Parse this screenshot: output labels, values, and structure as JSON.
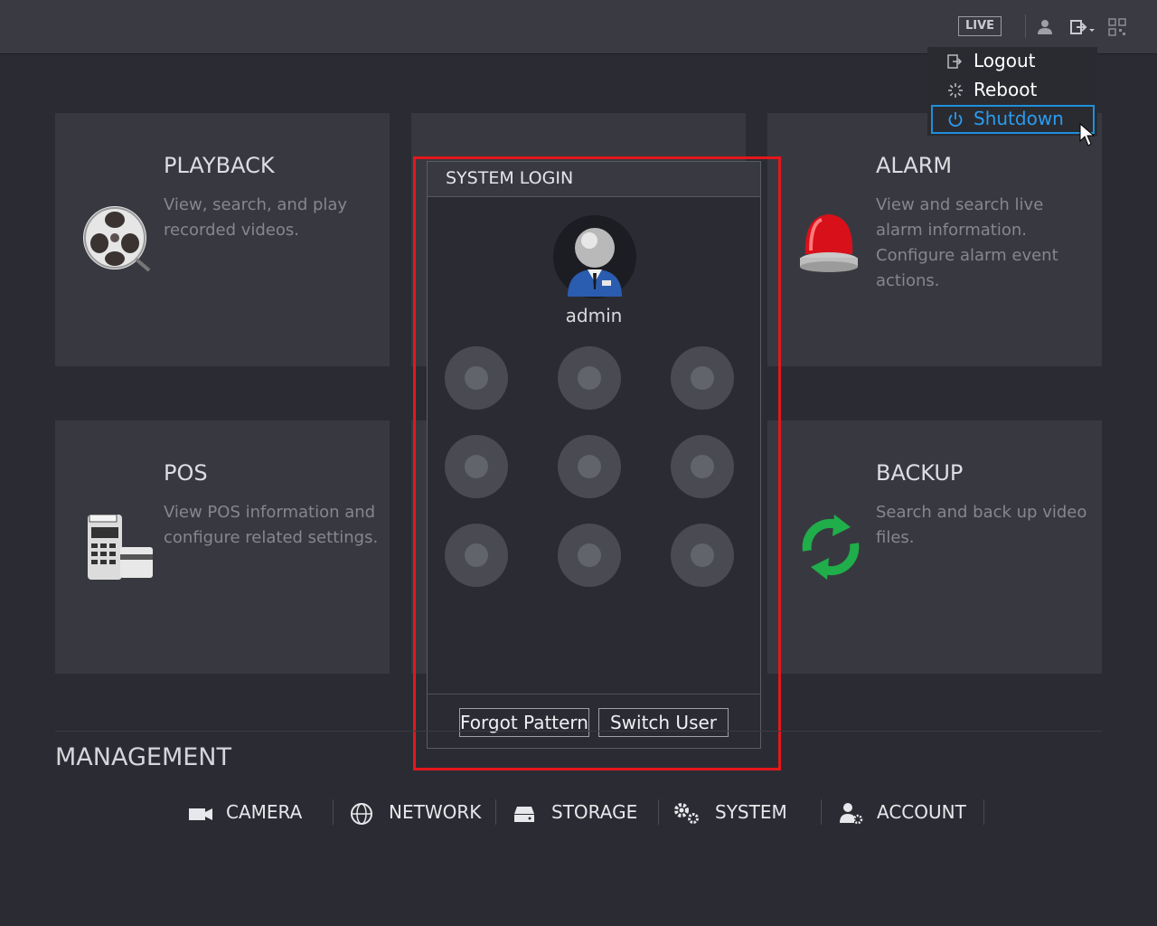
{
  "topbar": {
    "live_label": "LIVE",
    "icons": [
      "user-icon",
      "logout-menu-icon",
      "qr-code-icon"
    ]
  },
  "power_menu": {
    "items": [
      {
        "label": "Logout",
        "icon": "logout-icon"
      },
      {
        "label": "Reboot",
        "icon": "reboot-icon"
      },
      {
        "label": "Shutdown",
        "icon": "power-icon",
        "selected": true
      }
    ]
  },
  "tiles": {
    "playback": {
      "title": "PLAYBACK",
      "desc": "View, search, and play recorded videos.",
      "icon": "film-reel-icon"
    },
    "alarm": {
      "title": "ALARM",
      "desc": "View and search live alarm information. Configure alarm event actions.",
      "icon": "alarm-siren-icon"
    },
    "pos": {
      "title": "POS",
      "desc": "View POS information and configure related settings.",
      "icon": "cash-register-icon"
    },
    "backup": {
      "title": "BACKUP",
      "desc": "Search and back up video files.",
      "icon": "sync-arrows-icon"
    }
  },
  "login": {
    "title": "SYSTEM LOGIN",
    "username": "admin",
    "pattern_grid": "3x3",
    "forgot_label": "Forgot Pattern",
    "switch_label": "Switch User"
  },
  "management": {
    "title": "MANAGEMENT",
    "items": [
      {
        "label": "CAMERA",
        "icon": "camera-icon"
      },
      {
        "label": "NETWORK",
        "icon": "globe-icon"
      },
      {
        "label": "STORAGE",
        "icon": "hard-drive-icon"
      },
      {
        "label": "SYSTEM",
        "icon": "gears-icon"
      },
      {
        "label": "ACCOUNT",
        "icon": "user-settings-icon"
      }
    ]
  },
  "colors": {
    "background": "#2b2c33",
    "tile": "#383940",
    "highlight_border": "#e4171c",
    "selected_accent": "#2a9cf0"
  }
}
